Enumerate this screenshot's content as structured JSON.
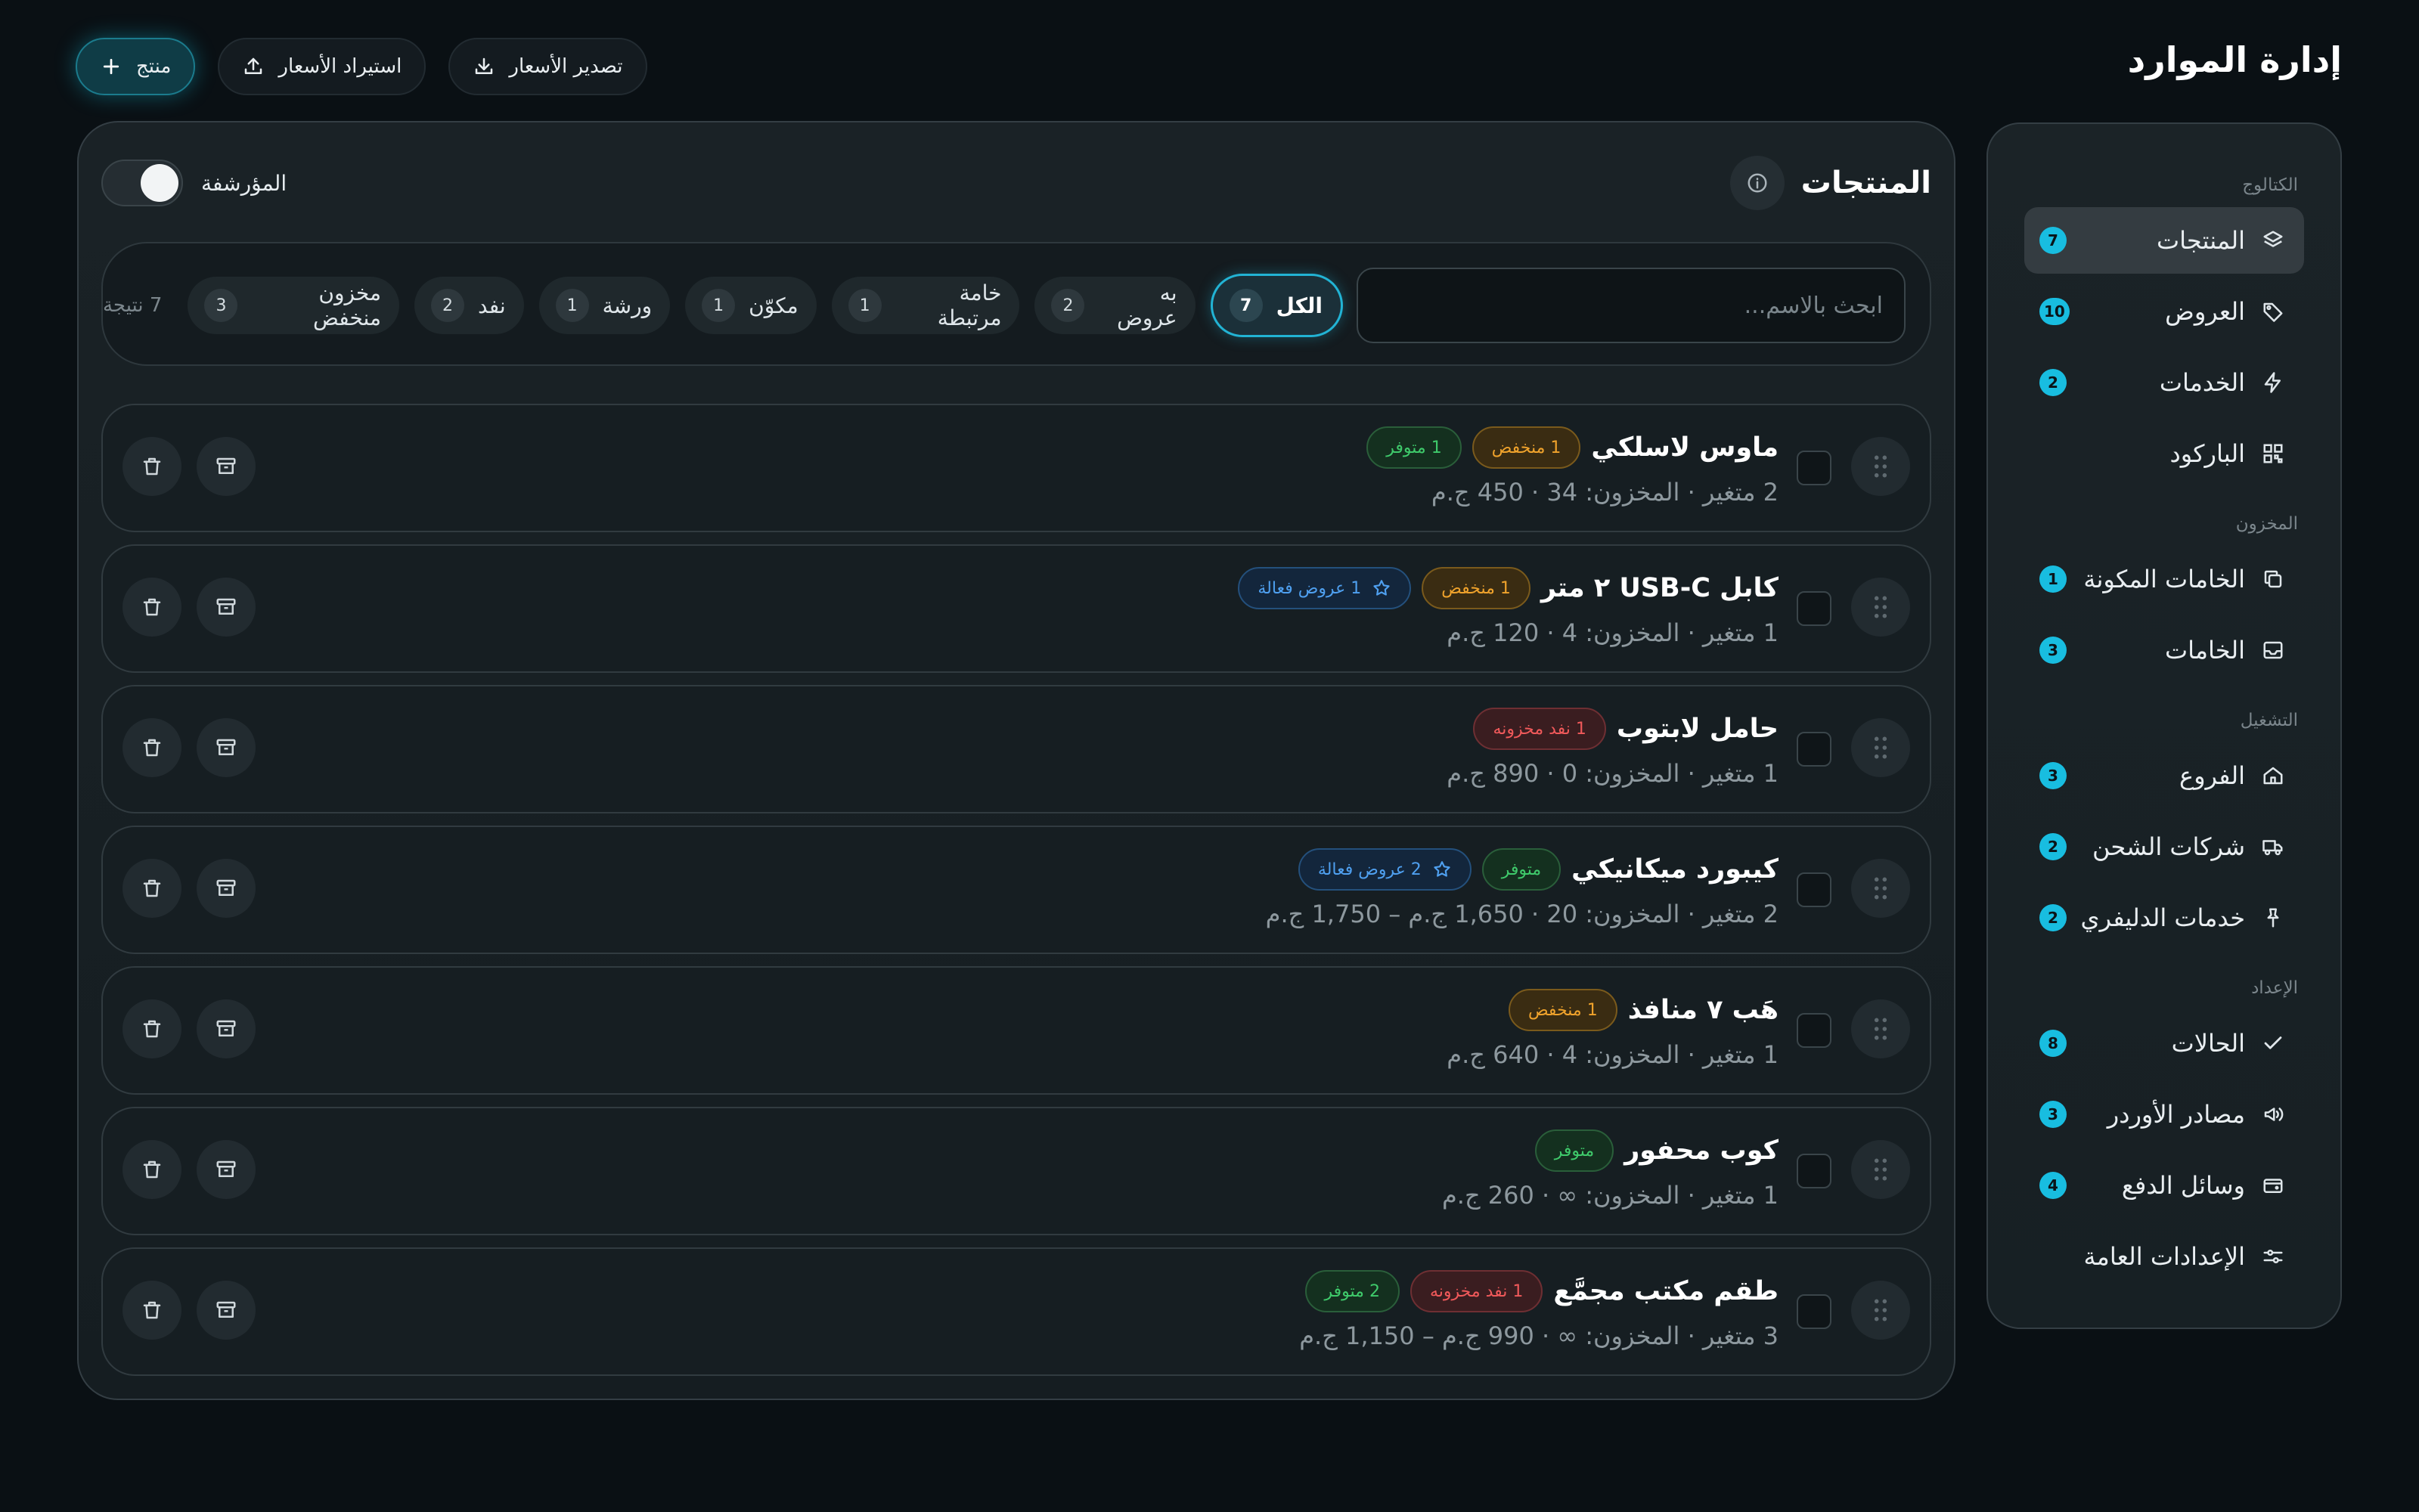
{
  "header": {
    "title": "إدارة الموارد",
    "actions": {
      "add_product": "منتج",
      "import_prices": "استيراد الأسعار",
      "export_prices": "تصدير الأسعار"
    }
  },
  "sidebar": {
    "sections": {
      "catalog": "الكتالوج",
      "inventory": "المخزون",
      "operations": "التشغيل",
      "setup": "الإعداد"
    },
    "items": {
      "products": {
        "label": "المنتجات",
        "count": "7",
        "icon": "layers-icon"
      },
      "offers": {
        "label": "العروض",
        "count": "10",
        "icon": "tag-icon"
      },
      "services": {
        "label": "الخدمات",
        "count": "2",
        "icon": "zap-icon"
      },
      "barcode": {
        "label": "الباركود",
        "icon": "qr-code-icon"
      },
      "components": {
        "label": "الخامات المكونة",
        "count": "1",
        "icon": "copy-icon"
      },
      "materials": {
        "label": "الخامات",
        "count": "3",
        "icon": "inbox-icon"
      },
      "branches": {
        "label": "الفروع",
        "count": "3",
        "icon": "home-icon"
      },
      "shipping": {
        "label": "شركات الشحن",
        "count": "2",
        "icon": "truck-icon"
      },
      "delivery": {
        "label": "خدمات الدليفري",
        "count": "2",
        "icon": "pin-icon"
      },
      "statuses": {
        "label": "الحالات",
        "count": "8",
        "icon": "check-icon"
      },
      "order_sources": {
        "label": "مصادر الأوردر",
        "count": "3",
        "icon": "megaphone-icon"
      },
      "payment": {
        "label": "وسائل الدفع",
        "count": "4",
        "icon": "wallet-icon"
      },
      "general_settings": {
        "label": "الإعدادات العامة",
        "icon": "sliders-icon"
      }
    },
    "active": "products"
  },
  "main": {
    "title": "المنتجات",
    "archived_label": "المؤرشفة",
    "archived_on": false,
    "search": {
      "placeholder": "ابحث بالاسم...",
      "value": ""
    },
    "filters": [
      {
        "label": "الكل",
        "count": "7",
        "selected": true
      },
      {
        "label": "به عروض",
        "count": "2"
      },
      {
        "label": "خامة مرتبطة",
        "count": "1"
      },
      {
        "label": "مكوّن",
        "count": "1"
      },
      {
        "label": "ورشة",
        "count": "1"
      },
      {
        "label": "نفد",
        "count": "2"
      },
      {
        "label": "مخزون منخفض",
        "count": "3"
      }
    ],
    "results_count": "7 نتيجة",
    "products": [
      {
        "name": "ماوس لاسلكي",
        "meta": "2 متغير · المخزون: 34 · 450 ج.م",
        "badges": [
          {
            "text": "1 منخفض",
            "color": "orange"
          },
          {
            "text": "1 متوفر",
            "color": "green"
          }
        ]
      },
      {
        "name": "كابل USB-C ٢ متر",
        "meta": "1 متغير · المخزون: 4 · 120 ج.م",
        "badges": [
          {
            "text": "1 منخفض",
            "color": "orange"
          },
          {
            "text": "1 عروض فعالة",
            "color": "blue",
            "icon": "star-icon"
          }
        ]
      },
      {
        "name": "حامل لابتوب",
        "meta": "1 متغير · المخزون: 0 · 890 ج.م",
        "badges": [
          {
            "text": "1 نفد مخزونه",
            "color": "red"
          }
        ]
      },
      {
        "name": "كيبورد ميكانيكي",
        "meta": "2 متغير · المخزون: 20 · 1,650 ج.م – 1,750 ج.م",
        "badges": [
          {
            "text": "متوفر",
            "color": "green"
          },
          {
            "text": "2 عروض فعالة",
            "color": "blue",
            "icon": "star-icon"
          }
        ]
      },
      {
        "name": "هَب ٧ منافذ",
        "meta": "1 متغير · المخزون: 4 · 640 ج.م",
        "badges": [
          {
            "text": "1 منخفض",
            "color": "orange"
          }
        ]
      },
      {
        "name": "كوب محفور",
        "meta": "1 متغير · المخزون: ∞ · 260 ج.م",
        "badges": [
          {
            "text": "متوفر",
            "color": "green"
          }
        ]
      },
      {
        "name": "طقم مكتب مجمَّع",
        "meta": "3 متغير · المخزون: ∞ · 990 ج.م – 1,150 ج.م",
        "badges": [
          {
            "text": "1 نفد مخزونه",
            "color": "red"
          },
          {
            "text": "2 متوفر",
            "color": "green"
          }
        ]
      }
    ]
  },
  "colors": {
    "accent": "#18bde0",
    "background": "#0a1014",
    "panel": "#1a2226",
    "badge_orange": "#f0a32c",
    "badge_green": "#3fca6b",
    "badge_red": "#f0595a",
    "badge_blue": "#4fa0f0"
  }
}
